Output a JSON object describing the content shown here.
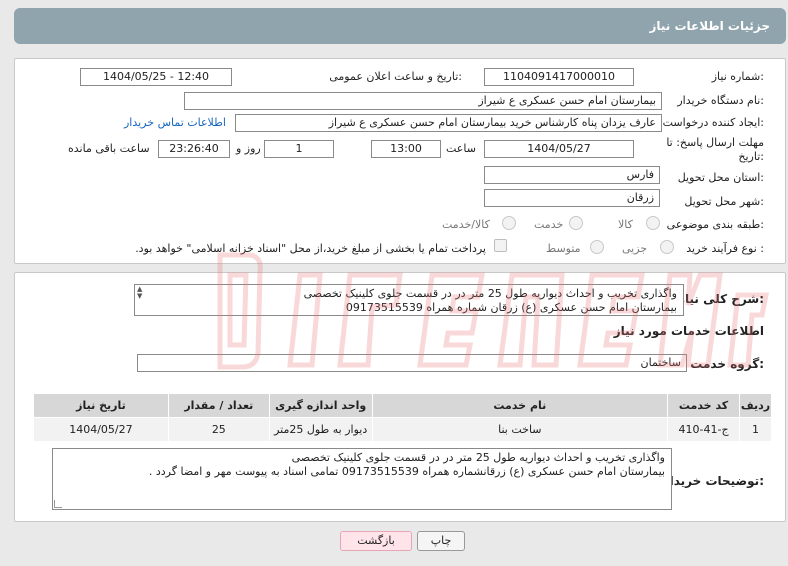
{
  "page": {
    "title": "جزئیات اطلاعات نیاز"
  },
  "form": {
    "need_number_label": "شماره نیاز:",
    "need_number": "1104091417000010",
    "announce_label": "تاریخ و ساعت اعلان عمومی:",
    "announce_value": "1404/05/25 - 12:40",
    "buyer_org_label": "نام دستگاه خریدار:",
    "buyer_org": "بیمارستان امام حسن عسکری  ع  شیراز",
    "creator_label": "ایجاد کننده درخواست:",
    "creator": "عارف یزدان پناه کارشناس خرید  بیمارستان امام حسن عسکری  ع  شیراز",
    "contact_link": "اطلاعات تماس خریدار",
    "deadline_label": "مهلت ارسال پاسخ: تا تاریخ:",
    "deadline_date": "1404/05/27",
    "time_label": "ساعت",
    "deadline_time": "13:00",
    "days_value": "1",
    "days_label": "روز و",
    "remaining_time": "23:26:40",
    "remaining_label": "ساعت باقی مانده",
    "province_label": "استان محل تحویل:",
    "province": "فارس",
    "city_label": "شهر محل تحویل:",
    "city": "زرقان",
    "category_label": "طبقه بندی موضوعی:",
    "category_options": [
      "کالا",
      "خدمت",
      "کالا/خدمت"
    ],
    "process_label": "نوع فرآیند خرید :",
    "process_options": [
      "جزیی",
      "متوسط"
    ],
    "payment_note": "پرداخت تمام یا بخشی از مبلغ خرید،از محل \"اسناد خزانه اسلامی\" خواهد بود."
  },
  "summary": {
    "label": "شرح کلی نیاز:",
    "line1": "واگذاری  تخریب و احداث دیواریه طول 25 متر در در قسمت جلوی کلینیک تخصصی",
    "line2": "بیمارستان امام حسن عسکری (ع) زرقان شماره همراه 09173515539"
  },
  "services": {
    "section_title": "اطلاعات خدمات مورد نیاز",
    "group_label": "گروه خدمت:",
    "group_value": "ساختمان",
    "headers": [
      "ردیف",
      "کد خدمت",
      "نام خدمت",
      "واحد اندازه گیری",
      "تعداد / مقدار",
      "تاریخ نیاز"
    ],
    "rows": [
      [
        "1",
        "ج-41-410",
        "ساخت بنا",
        "دیوار به طول 25متر",
        "25",
        "1404/05/27"
      ]
    ]
  },
  "buyer_notes": {
    "label": "توضیحات خریدار:",
    "line1": "واگذاری  تخریب و احداث دیواریه طول 25 متر در در قسمت جلوی کلینیک تخصصی",
    "line2": "بیمارستان امام حسن عسکری (ع) زرقانشماره همراه 09173515539 تمامی اسناد به پیوست مهر و امضا گردد ."
  },
  "buttons": {
    "print": "چاپ",
    "back": "بازگشت"
  },
  "colors": {
    "header": "#90a4ae",
    "link": "#1565c0",
    "watermark": "#e57373"
  }
}
